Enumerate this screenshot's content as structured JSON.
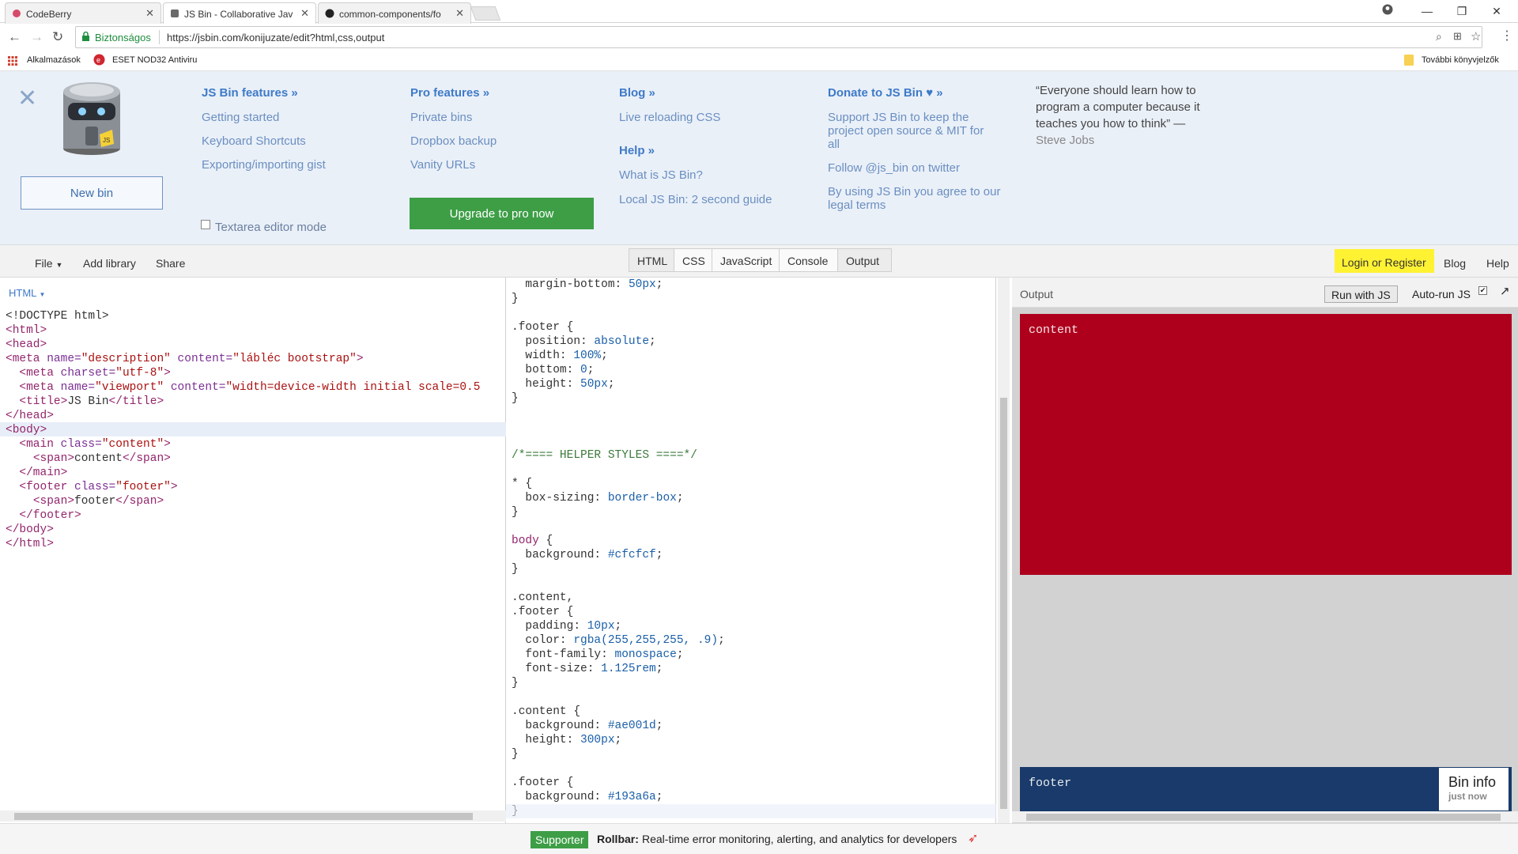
{
  "browser": {
    "tabs": [
      {
        "label": "CodeBerry"
      },
      {
        "label": "JS Bin - Collaborative Jav"
      },
      {
        "label": "common-components/fo"
      }
    ],
    "secure_label": "Biztonságos",
    "url": "https://jsbin.com/konijuzate/edit?html,css,output",
    "bookmarks": [
      {
        "label": "Alkalmazások"
      },
      {
        "label": "ESET NOD32 Antiviru"
      }
    ],
    "other_bookmarks": "További könyvjelzők"
  },
  "menu": {
    "new_bin": "New bin",
    "textarea_mode": "Textarea editor mode",
    "features": {
      "title": "JS Bin features »",
      "links": [
        "Getting started",
        "Keyboard Shortcuts",
        "Exporting/importing gist"
      ]
    },
    "pro": {
      "title": "Pro features »",
      "links": [
        "Private bins",
        "Dropbox backup",
        "Vanity URLs"
      ],
      "upgrade": "Upgrade to pro now"
    },
    "blog": {
      "title": "Blog »",
      "links": [
        "Live reloading CSS"
      ]
    },
    "help": {
      "title": "Help »",
      "links": [
        "What is JS Bin?",
        "Local JS Bin: 2 second guide"
      ]
    },
    "donate": {
      "title": "Donate to JS Bin",
      "title_suffix": "»",
      "support_line1": "Support JS Bin to keep the",
      "support_line2": "project open source & MIT for",
      "support_line3": "all",
      "twitter": "Follow @js_bin on twitter",
      "legal_line1": "By using JS Bin you agree to our",
      "legal_line2": "legal terms"
    },
    "quote": {
      "line1": "“Everyone should learn how to",
      "line2": "program a computer because it",
      "line3": "teaches you how to think” —",
      "author": "Steve Jobs"
    }
  },
  "controls": {
    "file": "File",
    "add_library": "Add library",
    "share": "Share",
    "panels": [
      "HTML",
      "CSS",
      "JavaScript",
      "Console",
      "Output"
    ],
    "login": "Login or Register",
    "blog": "Blog",
    "help": "Help"
  },
  "html_panel": {
    "label": "HTML",
    "lines": [
      [
        {
          "c": "pr",
          "t": "<!DOCTYPE html>"
        }
      ],
      [
        {
          "c": "tg",
          "t": "<html>"
        }
      ],
      [
        {
          "c": "tg",
          "t": "<head>"
        }
      ],
      [
        {
          "c": "tg",
          "t": "<meta "
        },
        {
          "c": "at",
          "t": "name="
        },
        {
          "c": "av",
          "t": "\"description\""
        },
        {
          "c": "at",
          "t": " content="
        },
        {
          "c": "av",
          "t": "\"lábléc bootstrap\""
        },
        {
          "c": "tg",
          "t": ">"
        }
      ],
      [
        {
          "c": "pr",
          "t": "  "
        },
        {
          "c": "tg",
          "t": "<meta "
        },
        {
          "c": "at",
          "t": "charset="
        },
        {
          "c": "av",
          "t": "\"utf-8\""
        },
        {
          "c": "tg",
          "t": ">"
        }
      ],
      [
        {
          "c": "pr",
          "t": "  "
        },
        {
          "c": "tg",
          "t": "<meta "
        },
        {
          "c": "at",
          "t": "name="
        },
        {
          "c": "av",
          "t": "\"viewport\""
        },
        {
          "c": "at",
          "t": " content="
        },
        {
          "c": "av",
          "t": "\"width=device-width initial scale=0.5"
        }
      ],
      [
        {
          "c": "pr",
          "t": "  "
        },
        {
          "c": "tg",
          "t": "<title>"
        },
        {
          "c": "pr",
          "t": "JS Bin"
        },
        {
          "c": "tg",
          "t": "</title>"
        }
      ],
      [
        {
          "c": "tg",
          "t": "</head>"
        }
      ],
      [
        {
          "c": "tg",
          "t": "<body>"
        }
      ],
      [
        {
          "c": "pr",
          "t": "  "
        },
        {
          "c": "tg",
          "t": "<main "
        },
        {
          "c": "at",
          "t": "class="
        },
        {
          "c": "av",
          "t": "\"content\""
        },
        {
          "c": "tg",
          "t": ">"
        }
      ],
      [
        {
          "c": "pr",
          "t": "    "
        },
        {
          "c": "tg",
          "t": "<span>"
        },
        {
          "c": "pr",
          "t": "content"
        },
        {
          "c": "tg",
          "t": "</span>"
        }
      ],
      [
        {
          "c": "pr",
          "t": "  "
        },
        {
          "c": "tg",
          "t": "</main>"
        }
      ],
      [
        {
          "c": "pr",
          "t": "  "
        },
        {
          "c": "tg",
          "t": "<footer "
        },
        {
          "c": "at",
          "t": "class="
        },
        {
          "c": "av",
          "t": "\"footer\""
        },
        {
          "c": "tg",
          "t": ">"
        }
      ],
      [
        {
          "c": "pr",
          "t": "    "
        },
        {
          "c": "tg",
          "t": "<span>"
        },
        {
          "c": "pr",
          "t": "footer"
        },
        {
          "c": "tg",
          "t": "</span>"
        }
      ],
      [
        {
          "c": "pr",
          "t": "  "
        },
        {
          "c": "tg",
          "t": "</footer>"
        }
      ],
      [
        {
          "c": "tg",
          "t": "</body>"
        }
      ],
      [
        {
          "c": "tg",
          "t": "</html>"
        }
      ]
    ]
  },
  "css_panel": {
    "lines": [
      [
        {
          "c": "pr",
          "t": "  margin-bottom: "
        },
        {
          "c": "vl",
          "t": "50px"
        },
        {
          "c": "pr",
          "t": ";"
        }
      ],
      [
        {
          "c": "pr",
          "t": "}"
        }
      ],
      [],
      [
        {
          "c": "pr",
          "t": ".footer {"
        }
      ],
      [
        {
          "c": "pr",
          "t": "  position: "
        },
        {
          "c": "vl",
          "t": "absolute"
        },
        {
          "c": "pr",
          "t": ";"
        }
      ],
      [
        {
          "c": "pr",
          "t": "  width: "
        },
        {
          "c": "vl",
          "t": "100%"
        },
        {
          "c": "pr",
          "t": ";"
        }
      ],
      [
        {
          "c": "pr",
          "t": "  bottom: "
        },
        {
          "c": "vl",
          "t": "0"
        },
        {
          "c": "pr",
          "t": ";"
        }
      ],
      [
        {
          "c": "pr",
          "t": "  height: "
        },
        {
          "c": "vl",
          "t": "50px"
        },
        {
          "c": "pr",
          "t": ";"
        }
      ],
      [
        {
          "c": "pr",
          "t": "}"
        }
      ],
      [],
      [],
      [],
      [
        {
          "c": "cm",
          "t": "/*==== HELPER STYLES ====*/"
        }
      ],
      [],
      [
        {
          "c": "pr",
          "t": "* {"
        }
      ],
      [
        {
          "c": "pr",
          "t": "  box-sizing: "
        },
        {
          "c": "vl",
          "t": "border-box"
        },
        {
          "c": "pr",
          "t": ";"
        }
      ],
      [
        {
          "c": "pr",
          "t": "}"
        }
      ],
      [],
      [
        {
          "c": "tg",
          "t": "body"
        },
        {
          "c": "pr",
          "t": " {"
        }
      ],
      [
        {
          "c": "pr",
          "t": "  background: "
        },
        {
          "c": "vl",
          "t": "#cfcfcf"
        },
        {
          "c": "pr",
          "t": ";"
        }
      ],
      [
        {
          "c": "pr",
          "t": "}"
        }
      ],
      [],
      [
        {
          "c": "pr",
          "t": ".content,"
        }
      ],
      [
        {
          "c": "pr",
          "t": ".footer {"
        }
      ],
      [
        {
          "c": "pr",
          "t": "  padding: "
        },
        {
          "c": "vl",
          "t": "10px"
        },
        {
          "c": "pr",
          "t": ";"
        }
      ],
      [
        {
          "c": "pr",
          "t": "  color: "
        },
        {
          "c": "vl",
          "t": "rgba(255,255,255, .9)"
        },
        {
          "c": "pr",
          "t": ";"
        }
      ],
      [
        {
          "c": "pr",
          "t": "  font-family: "
        },
        {
          "c": "vl",
          "t": "monospace"
        },
        {
          "c": "pr",
          "t": ";"
        }
      ],
      [
        {
          "c": "pr",
          "t": "  font-size: "
        },
        {
          "c": "vl",
          "t": "1.125rem"
        },
        {
          "c": "pr",
          "t": ";"
        }
      ],
      [
        {
          "c": "pr",
          "t": "}"
        }
      ],
      [],
      [
        {
          "c": "pr",
          "t": ".content {"
        }
      ],
      [
        {
          "c": "pr",
          "t": "  background: "
        },
        {
          "c": "vl",
          "t": "#ae001d"
        },
        {
          "c": "pr",
          "t": ";"
        }
      ],
      [
        {
          "c": "pr",
          "t": "  height: "
        },
        {
          "c": "vl",
          "t": "300px"
        },
        {
          "c": "pr",
          "t": ";"
        }
      ],
      [
        {
          "c": "pr",
          "t": "}"
        }
      ],
      [],
      [
        {
          "c": "pr",
          "t": ".footer {"
        }
      ],
      [
        {
          "c": "pr",
          "t": "  background: "
        },
        {
          "c": "vl",
          "t": "#193a6a"
        },
        {
          "c": "pr",
          "t": ";"
        }
      ],
      [
        {
          "c": "pr",
          "t": "}"
        }
      ]
    ]
  },
  "output": {
    "label": "Output",
    "run_button": "Run with JS",
    "autorun": "Auto-run JS",
    "content_text": "content",
    "footer_text": "footer",
    "content_color": "#ae001d",
    "footer_color": "#193a6a",
    "bin_info": "Bin info",
    "bin_info_sub": "just now"
  },
  "status": {
    "badge": "Supporter",
    "brand": "Rollbar:",
    "text": "Real-time error monitoring, alerting, and analytics for developers"
  }
}
